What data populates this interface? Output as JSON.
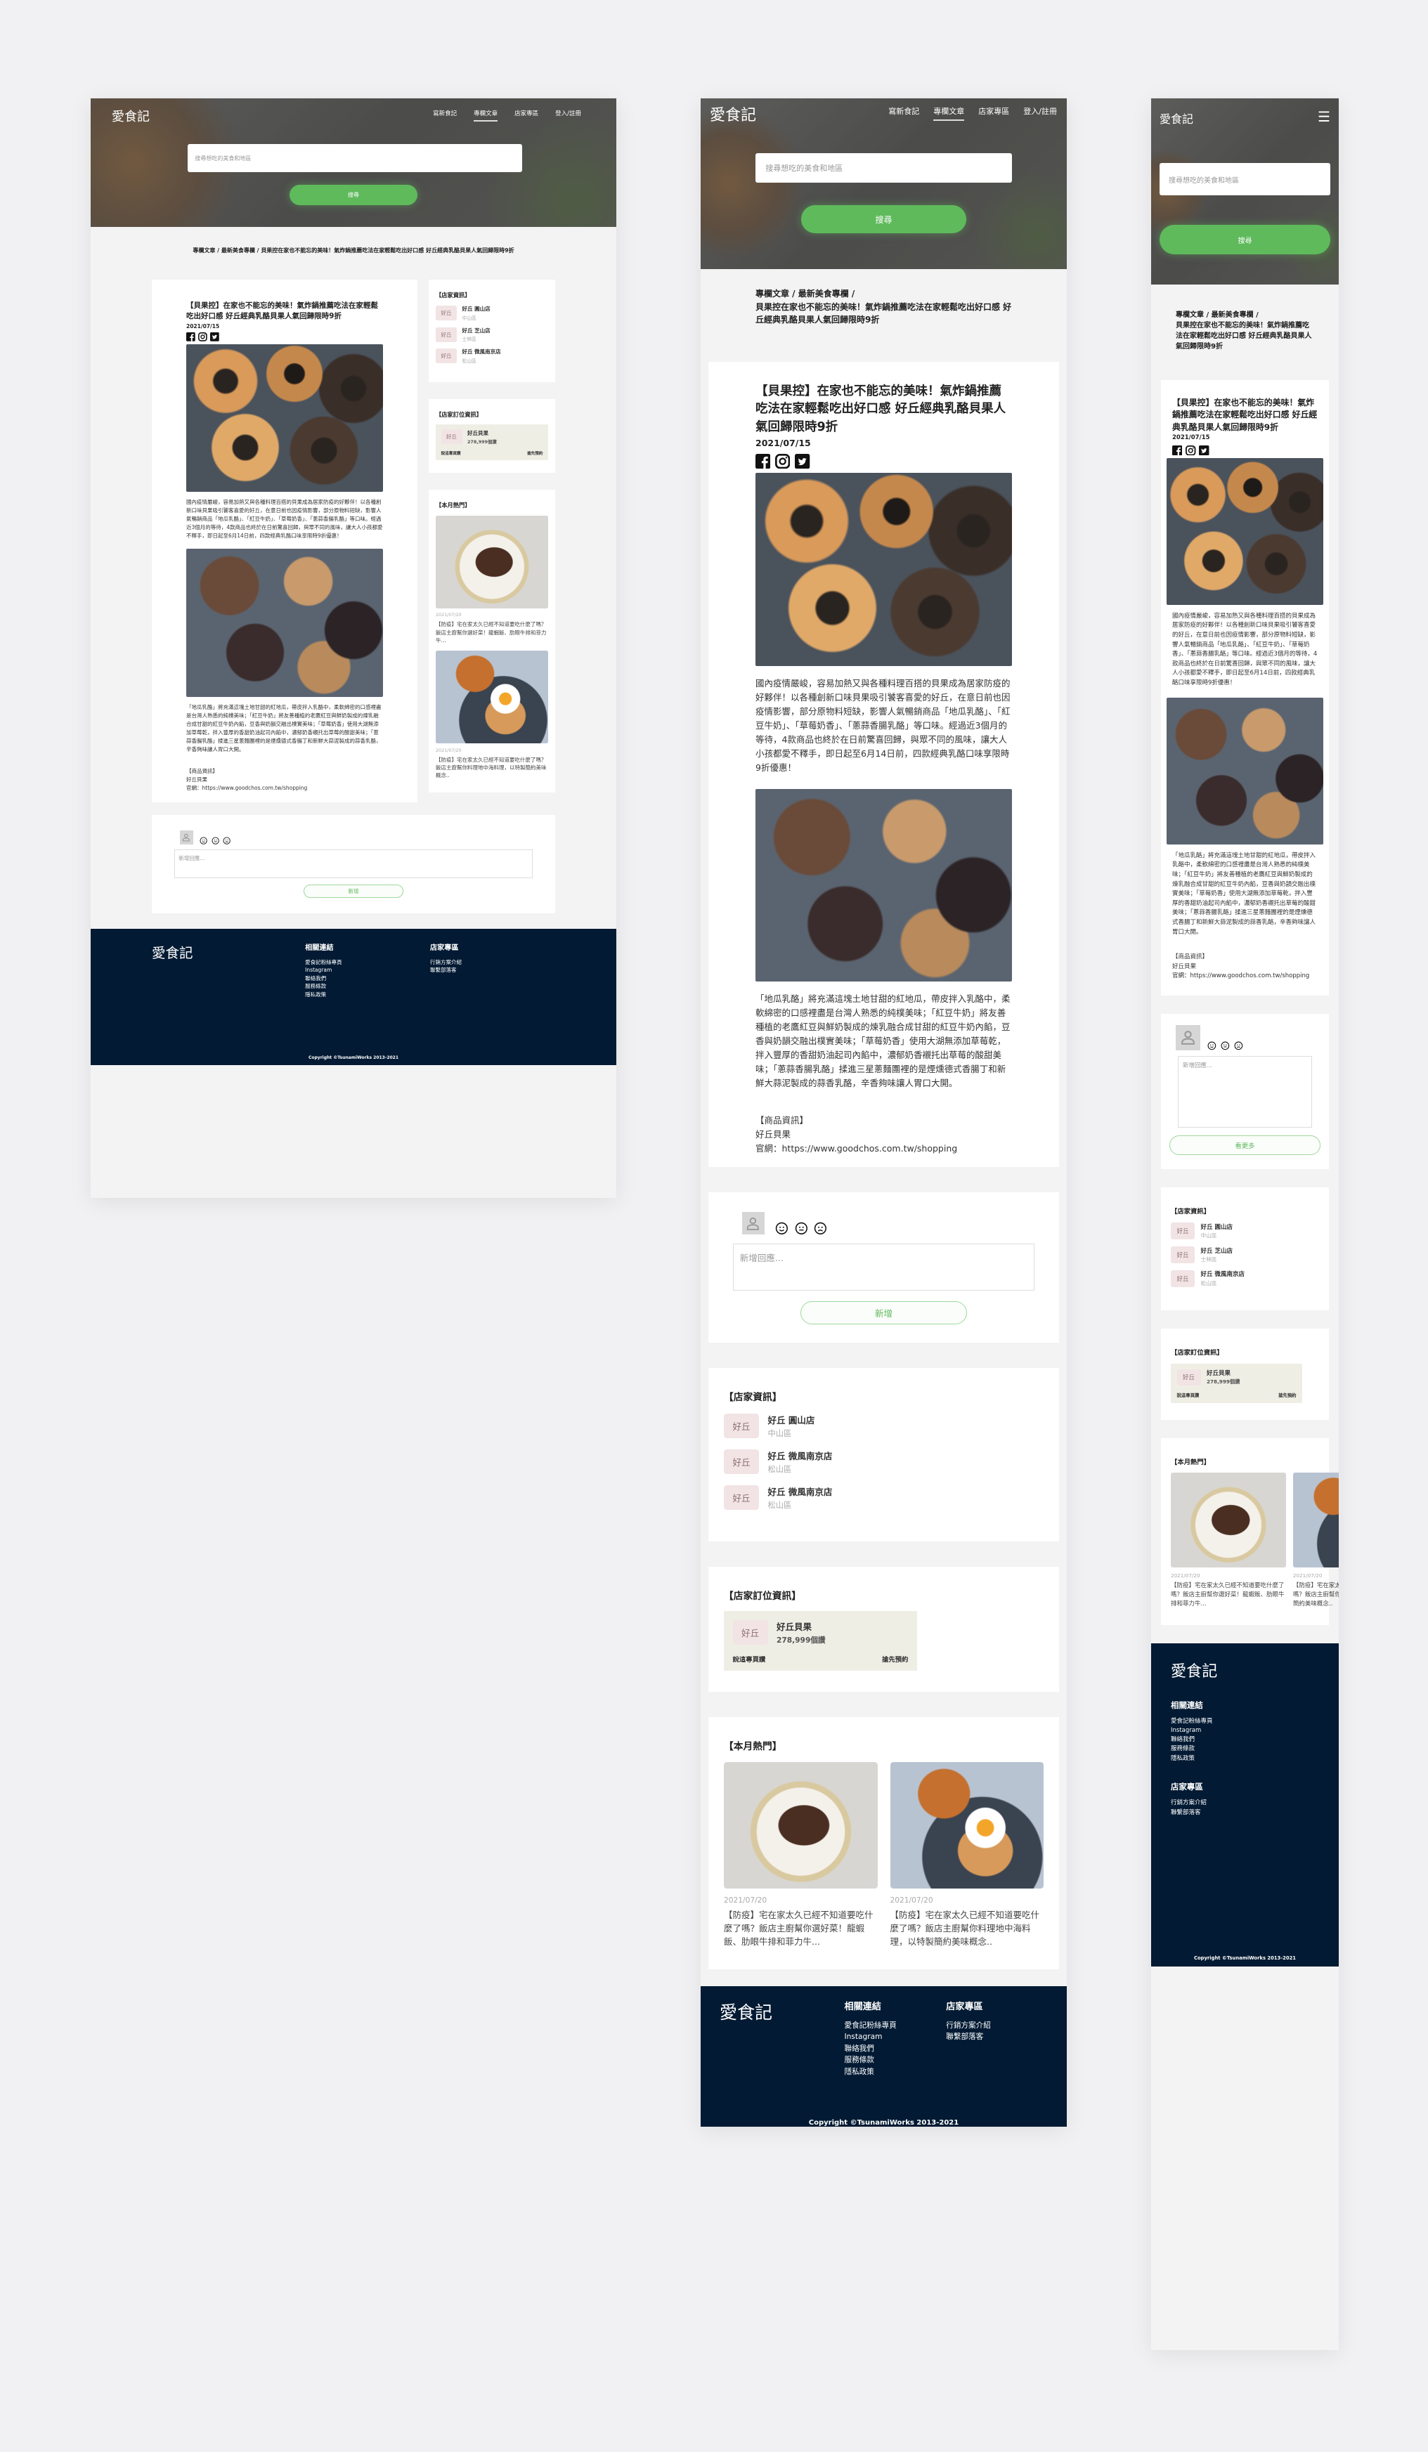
{
  "brand": "愛食記",
  "nav": [
    {
      "label": "寫新食記"
    },
    {
      "label": "專欄文章",
      "active": true
    },
    {
      "label": "店家專區"
    },
    {
      "label": "登入/註冊"
    }
  ],
  "search": {
    "placeholder": "搜尋想吃的美食和地區",
    "button": "搜尋"
  },
  "breadcrumb": {
    "path": "專欄文章 / 最新美食專欄 / ",
    "current": "貝果控在家也不能忘的美味！氣炸鍋推薦吃法在家輕鬆吃出好口感 好丘經典乳酪貝果人氣回歸限時9折"
  },
  "article": {
    "title": "【貝果控】在家也不能忘的美味！氣炸鍋推薦吃法在家輕鬆吃出好口感 好丘經典乳酪貝果人氣回歸限時9折",
    "date": "2021/07/15",
    "paragraphs": [
      "國內疫情嚴峻，容易加熱又與各種料理百搭的貝果成為居家防疫的好夥伴！以各種創新口味貝果吸引饕客喜愛的好丘，在意日前也因疫情影響，部分原物料短缺，影響人氣暢銷商品「地瓜乳酪」、「紅豆牛奶」、「草莓奶香」、「蔥蒜香腸乳酪」等口味。經過近3個月的等待，4款商品也終於在日前驚喜回歸，與眾不同的風味，讓大人小孩都愛不釋手，即日起至6月14日前，四款經典乳酪口味享限時9折優惠！",
      "「地瓜乳酪」將充滿這塊土地甘甜的紅地瓜，帶皮拌入乳酪中，柔軟綿密的口感裡盡是台灣人熟悉的純樸美味；「紅豆牛奶」將友善種植的老鷹紅豆與鮮奶製成的煉乳融合成甘甜的紅豆牛奶內餡，豆香與奶韻交融出樸實美味；「草莓奶香」使用大湖無添加草莓乾，拌入豐厚的香甜奶油起司內餡中，濃郁奶香襯托出草莓的酸甜美味；「蔥蒜香腸乳酪」揉進三星蔥麵團裡的是煙燻德式香腸丁和新鮮大蒜泥製成的蒜香乳酪，辛香夠味讓人胃口大開。"
    ],
    "product_heading": "【商品資訊】",
    "product_name": "好丘貝果",
    "product_url": "官網：https://www.goodchos.com.tw/shopping"
  },
  "comment": {
    "placeholder": "新增回應...",
    "submit": "新增",
    "more": "看更多"
  },
  "store_logo": "好丘",
  "stores_heading": "【店家資訊】",
  "stores": [
    {
      "name": "好丘 圓山店",
      "area": "中山區"
    },
    {
      "name": "好丘 芝山店",
      "area": "士林區"
    },
    {
      "name": "好丘 微風南京店",
      "area": "松山區"
    }
  ],
  "stores_tablet": [
    {
      "name": "好丘 圓山店",
      "area": "中山區"
    },
    {
      "name": "好丘 微風南京店",
      "area": "松山區"
    },
    {
      "name": "好丘 微風南京店",
      "area": "松山區"
    }
  ],
  "booking": {
    "heading": "【店家訂位資訊】",
    "name": "好丘貝果",
    "likes": "278,999個讚",
    "like_page": "說這專頁讚",
    "reserve": "搶先預約"
  },
  "popular": {
    "heading": "【本月熱門】",
    "posts": [
      {
        "date": "2021/07/20",
        "title": "【防疫】宅在家太久已經不知道要吃什麼了嗎？飯店主廚幫你選好菜！龍蝦飯、肋眼牛排和菲力牛..."
      },
      {
        "date": "2021/07/20",
        "title": "【防疫】宅在家太久已經不知道要吃什麼了嗎？飯店主廚幫你料理地中海料理，以特製簡約美味概念.."
      }
    ]
  },
  "footer": {
    "brand": "愛食記",
    "links_heading": "相關連結",
    "links": [
      "愛食記粉絲專頁",
      "Instagram",
      "聯絡我們",
      "服務條款",
      "隱私政策"
    ],
    "store_heading": "店家專區",
    "store_links": [
      "行銷方案介紹",
      "聯繫部落客"
    ],
    "copyright": "Copyright ©TsunamiWorks 2013-2021"
  },
  "colors": {
    "accent": "#5fba5c",
    "footer": "#021a33",
    "page": "#f3f3f3"
  }
}
